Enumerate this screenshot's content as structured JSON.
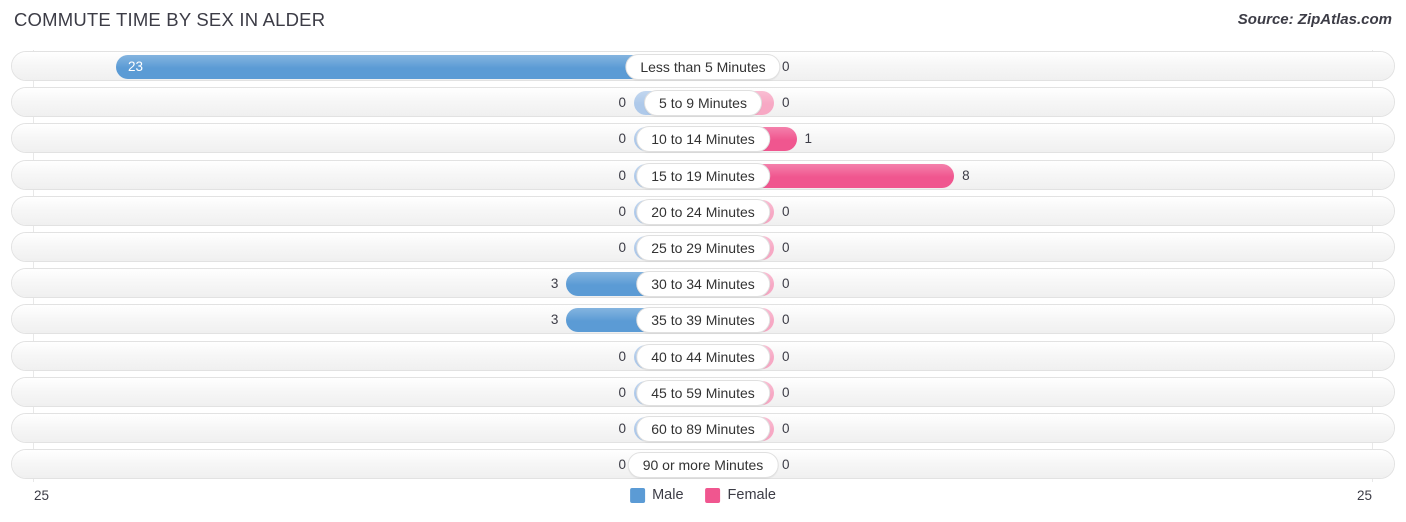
{
  "header": {
    "title": "COMMUTE TIME BY SEX IN ALDER",
    "source": "Source: ZipAtlas.com"
  },
  "legend": {
    "male_label": "Male",
    "female_label": "Female",
    "male_color": "#5b9bd5",
    "female_color": "#f0568f"
  },
  "axis": {
    "left_label": "25",
    "right_label": "25"
  },
  "chart_data": {
    "type": "bar",
    "title": "COMMUTE TIME BY SEX IN ALDER",
    "orientation": "horizontal-diverging",
    "xlabel": "",
    "ylabel": "",
    "xlim": [
      25,
      25
    ],
    "grid": false,
    "legend_position": "bottom-center",
    "categories": [
      "Less than 5 Minutes",
      "5 to 9 Minutes",
      "10 to 14 Minutes",
      "15 to 19 Minutes",
      "20 to 24 Minutes",
      "25 to 29 Minutes",
      "30 to 34 Minutes",
      "35 to 39 Minutes",
      "40 to 44 Minutes",
      "45 to 59 Minutes",
      "60 to 89 Minutes",
      "90 or more Minutes"
    ],
    "series": [
      {
        "name": "Male",
        "values": [
          23,
          0,
          0,
          0,
          0,
          0,
          3,
          3,
          0,
          0,
          0,
          0
        ]
      },
      {
        "name": "Female",
        "values": [
          0,
          0,
          1,
          8,
          0,
          0,
          0,
          0,
          0,
          0,
          0,
          0
        ]
      }
    ],
    "value_labels": {
      "male": [
        "23",
        "0",
        "0",
        "0",
        "0",
        "0",
        "3",
        "3",
        "0",
        "0",
        "0",
        "0"
      ],
      "female": [
        "0",
        "0",
        "1",
        "8",
        "0",
        "0",
        "0",
        "0",
        "0",
        "0",
        "0",
        "0"
      ]
    }
  }
}
